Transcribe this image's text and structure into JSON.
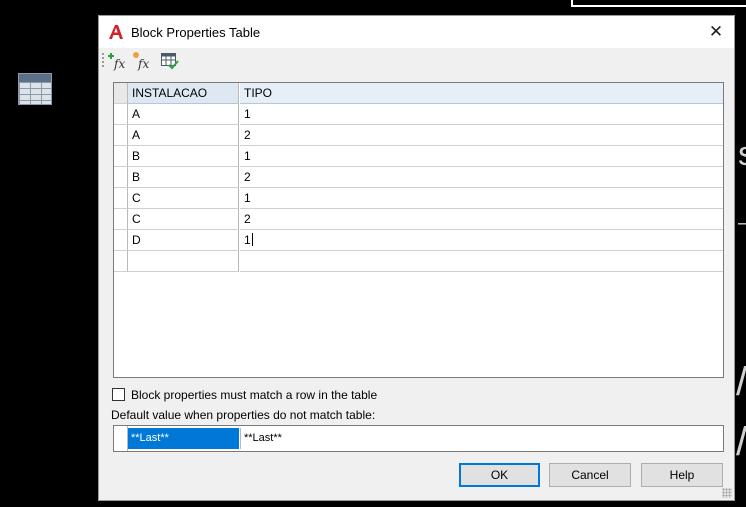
{
  "dialog": {
    "title": "Block Properties Table",
    "close_label": "✕"
  },
  "toolbar": {
    "buttons": [
      {
        "name": "new-property-parameter",
        "icon": "fx-add-icon"
      },
      {
        "name": "add-properties",
        "icon": "fx-star-icon"
      },
      {
        "name": "audit",
        "icon": "table-check-icon"
      }
    ]
  },
  "table": {
    "columns": [
      "INSTALACAO",
      "TIPO"
    ],
    "rows": [
      [
        "A",
        "1"
      ],
      [
        "A",
        "2"
      ],
      [
        "B",
        "1"
      ],
      [
        "B",
        "2"
      ],
      [
        "C",
        "1"
      ],
      [
        "C",
        "2"
      ],
      [
        "D",
        "1"
      ],
      [
        "",
        ""
      ]
    ]
  },
  "options": {
    "must_match_label": "Block properties must match a row in the table",
    "must_match_checked": false,
    "default_label": "Default value when properties do not match table:",
    "default_values": [
      "**Last**",
      "**Last**"
    ]
  },
  "buttons": {
    "ok": "OK",
    "cancel": "Cancel",
    "help": "Help"
  },
  "colors": {
    "accent": "#0078d7",
    "header_bg": "#dde8f3",
    "app_icon": "#d3232a"
  }
}
